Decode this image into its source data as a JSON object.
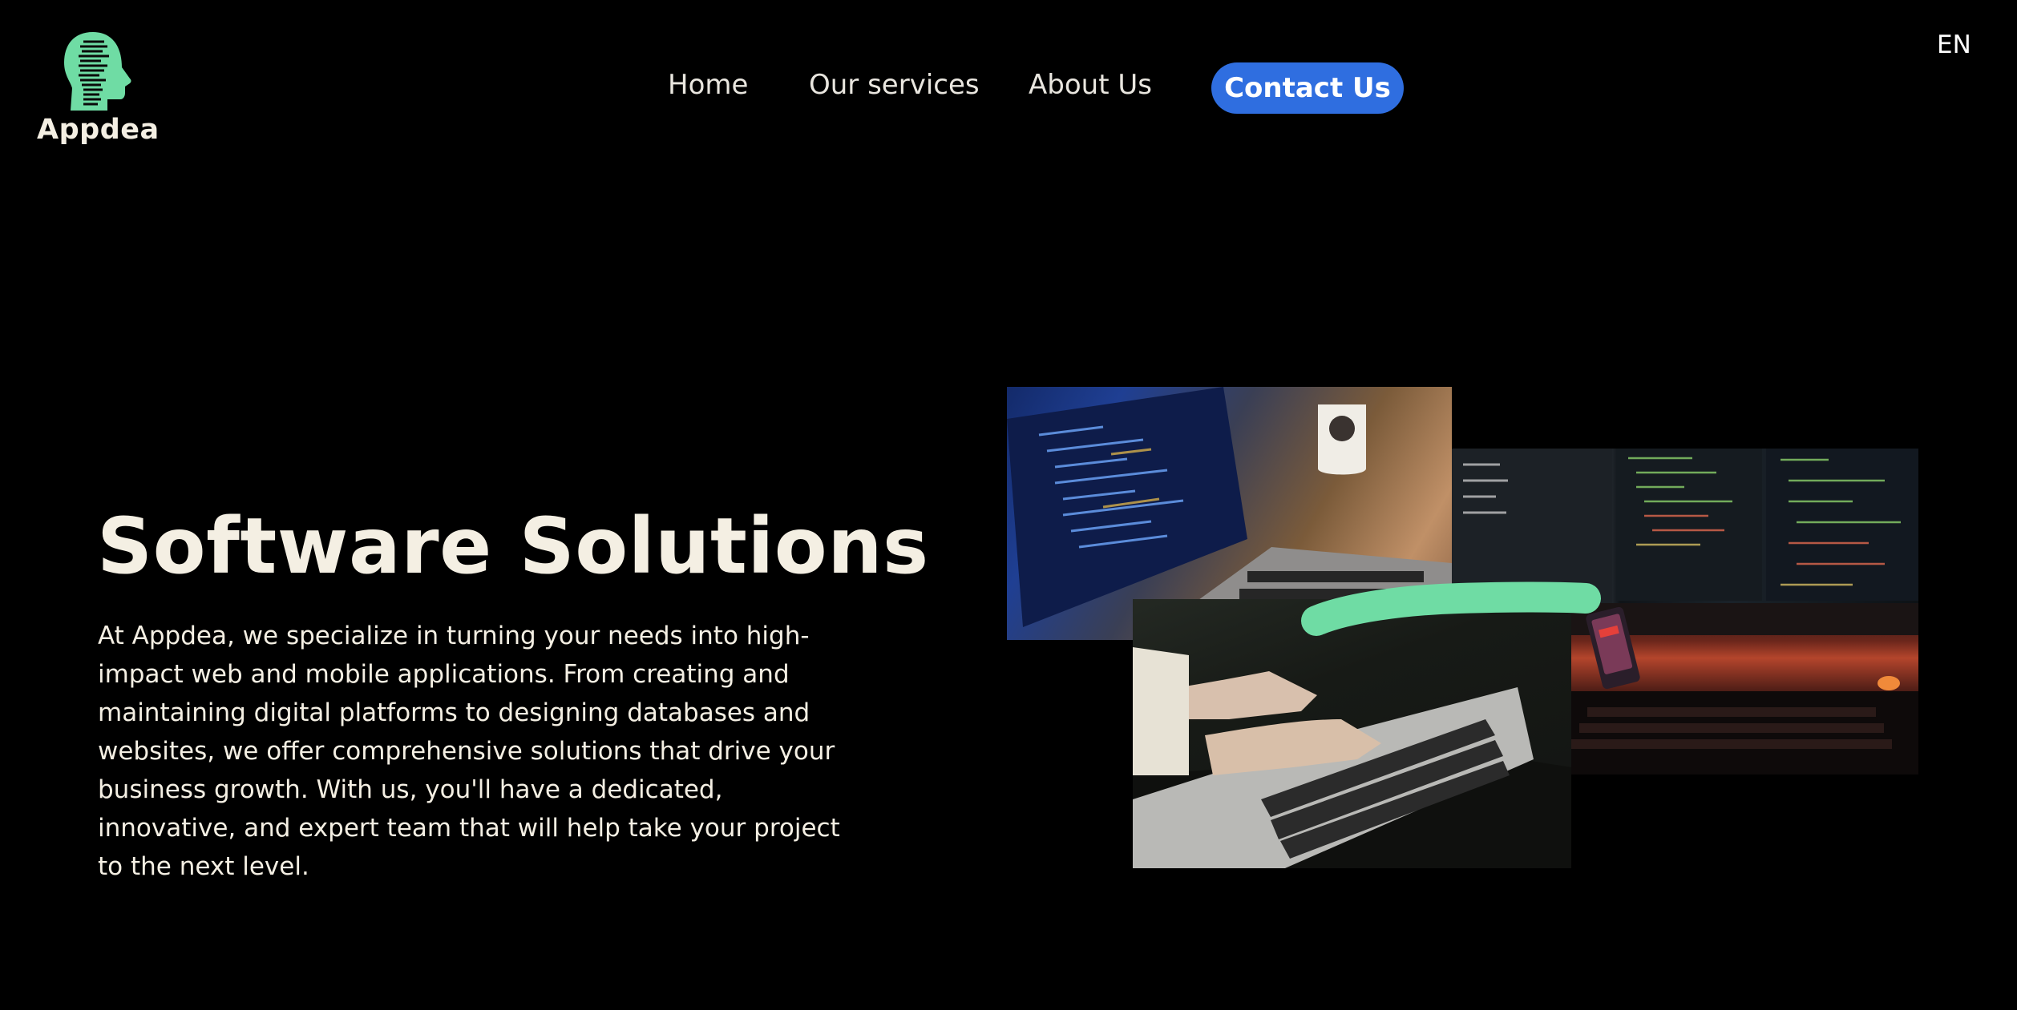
{
  "brand": {
    "name": "Appdea",
    "logo_icon": "head-code-icon",
    "accent": "#6fdca4"
  },
  "nav": {
    "items": [
      "Home",
      "Our services",
      "About Us"
    ],
    "contact_label": "Contact Us",
    "contact_color": "#2f6ee0",
    "language": "EN"
  },
  "hero": {
    "title": "Software Solutions",
    "description": "At Appdea, we specialize in turning your needs into high-impact web and mobile applications. From creating and maintaining digital platforms to designing databases and websites, we offer comprehensive solutions that drive your business growth. With us, you'll have a dedicated, innovative, and expert team that will help take your project to the next level."
  },
  "collage": {
    "images": [
      "laptop-code-photo",
      "monitors-code-photo",
      "typing-laptop-photo",
      "keyboard-phone-photo"
    ]
  }
}
